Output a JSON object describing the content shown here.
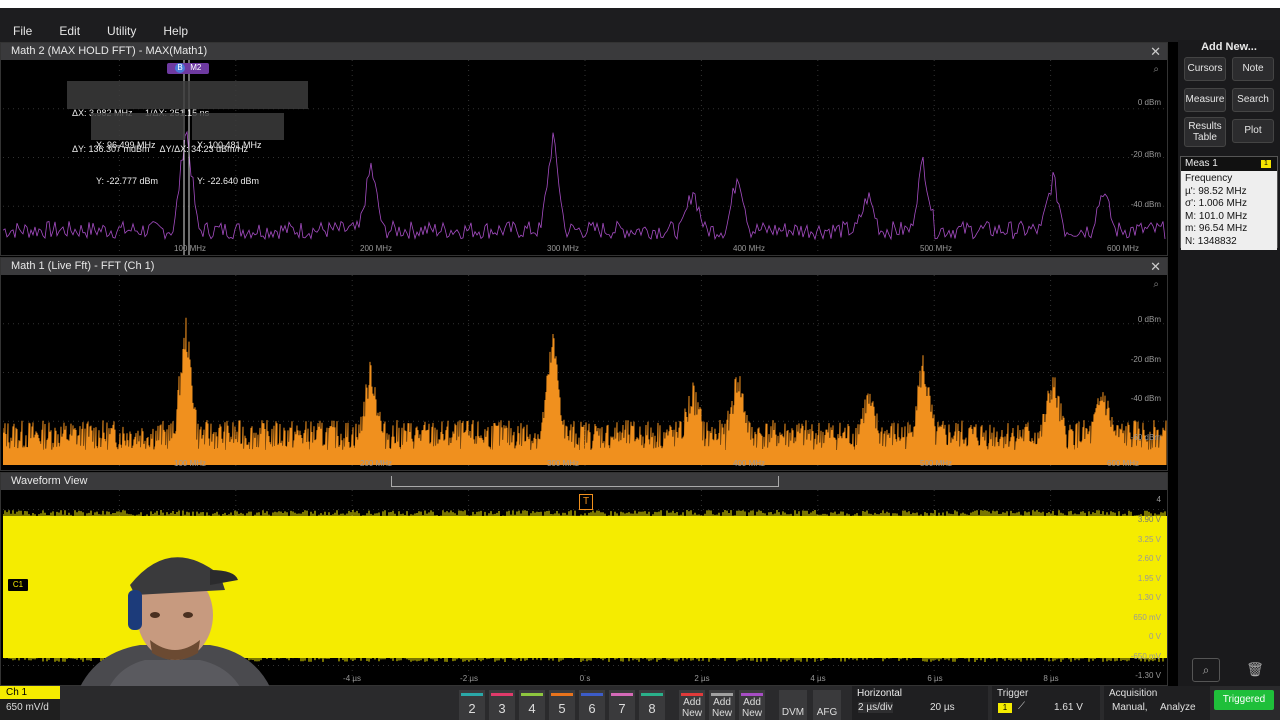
{
  "menu": [
    "File",
    "Edit",
    "Utility",
    "Help"
  ],
  "panel_math2": {
    "title": "Math 2 (MAX HOLD FFT) - MAX(Math1)",
    "y_ticks": [
      "0 dBm",
      "-20 dBm",
      "-40 dBm"
    ],
    "x_ticks": [
      "100 MHz",
      "200 MHz",
      "300 MHz",
      "400 MHz",
      "500 MHz",
      "600 MHz"
    ],
    "trace_color": "#a64dc4",
    "cursor_badges": [
      "B",
      "M2"
    ],
    "delta_line1": "ΔX: 3.982 MHz     1/ΔX: 251.15 ns",
    "delta_line2": "ΔY: 136.307 mdBm    ΔY/ΔX: 34.23 dBm/Hz",
    "cursor_a_line1": "X: 96.499 MHz",
    "cursor_a_line2": "Y: -22.777 dBm",
    "cursor_b_line1": "X: 100.481 MHz",
    "cursor_b_line2": "Y: -22.640 dBm"
  },
  "panel_math1": {
    "title": "Math 1 (Live Fft) - FFT (Ch 1)",
    "y_ticks": [
      "0 dBm",
      "-20 dBm",
      "-40 dBm",
      "-60 dBm"
    ],
    "x_ticks": [
      "100 MHz",
      "200 MHz",
      "300 MHz",
      "400 MHz",
      "500 MHz",
      "600 MHz"
    ],
    "trace_color": "#f0901e"
  },
  "panel_waveform": {
    "title": "Waveform View",
    "y_ticks": [
      "4",
      "3.90 V",
      "3.25 V",
      "2.60 V",
      "1.95 V",
      "1.30 V",
      "650 mV",
      "0 V",
      "-650 mV",
      "-1.30 V"
    ],
    "x_ticks": [
      "-4 µs",
      "-2 µs",
      "0 s",
      "2 µs",
      "4 µs",
      "6 µs",
      "8 µs"
    ],
    "trace_color": "#f5ec00",
    "channel_marker": "C1",
    "trigger_marker": "T"
  },
  "right_panel": {
    "add_new": "Add New...",
    "cursors": "Cursors",
    "note": "Note",
    "measure": "Measure",
    "search": "Search",
    "results_table": "Results Table",
    "plot": "Plot",
    "meas_title": "Meas 1",
    "meas_badge": "1",
    "meas_lines": [
      "Frequency",
      "µ': 98.52 MHz",
      "σ': 1.006 MHz",
      "M: 101.0 MHz",
      "m: 96.54 MHz",
      "N: 1348832"
    ]
  },
  "bottom": {
    "ch1_label": "Ch 1",
    "ch1_scale": "650 mV/d",
    "channels": [
      "2",
      "3",
      "4",
      "5",
      "6",
      "7",
      "8"
    ],
    "channel_colors": [
      "#2aa8a8",
      "#e03a6a",
      "#8ec63f",
      "#e8731c",
      "#3c5cc8",
      "#d46ab8",
      "#2ab08a"
    ],
    "new_buttons": [
      "Add New",
      "Add New",
      "Add New"
    ],
    "new_colors": [
      "#e03a3a",
      "#a0a0a0",
      "#a64dc4"
    ],
    "dvm": "DVM",
    "afg": "AFG",
    "horizontal_title": "Horizontal",
    "horizontal_scale": "2 µs/div",
    "horizontal_pos": "20 µs",
    "trigger_title": "Trigger",
    "trigger_ch": "1",
    "trigger_level": "1.61 V",
    "acq_title": "Acquisition",
    "acq_mode": "Manual,",
    "acq_analyze": "Analyze",
    "status": "Triggered"
  }
}
